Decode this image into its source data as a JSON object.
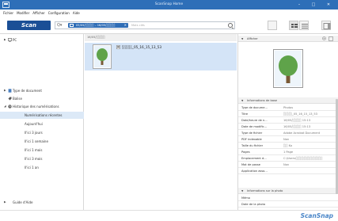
{
  "window": {
    "title": "ScanSnap Home"
  },
  "menu": [
    "Fichier",
    "Modifier",
    "Afficher",
    "Configuration",
    "Aide"
  ],
  "toolbar": {
    "scan_label": "Scan",
    "date_filter": "05/05/░░░░ – 16/05/░░░░",
    "search_placeholder": "Mots clés"
  },
  "sidebar": {
    "pc_label": "PC",
    "items": [
      {
        "label": "Type de document",
        "icon": "doc-type-icon"
      },
      {
        "label": "Balise",
        "icon": "tag-icon"
      },
      {
        "label": "Historique des numérisations",
        "icon": "history-icon"
      },
      {
        "label": "Numérisations récentes",
        "selected": true
      },
      {
        "label": "Aujourd'hui"
      },
      {
        "label": "Il'ici 3 jours"
      },
      {
        "label": "Il'ici 1 semaine"
      },
      {
        "label": "Il'ici 1 mois"
      },
      {
        "label": "Il'ici 3 mois"
      },
      {
        "label": "Il'ici 1 an"
      }
    ],
    "help_label": "Guide d'Aide"
  },
  "list": {
    "group_date": "16/05/░░░░",
    "file_name": "░░░░_05_16_15_13_53"
  },
  "details": {
    "preview_header": "Afficher",
    "basic_header": "Informations de base",
    "properties": [
      {
        "key": "Type de docume...",
        "value": "Photos"
      },
      {
        "key": "Titre",
        "value": "░░░░_05_16_15_13_53"
      },
      {
        "key": "Date/heure de n...",
        "value": "16/05/░░░░ 15:13"
      },
      {
        "key": "Date de modific...",
        "value": "16/05/░░░░ 15:13"
      },
      {
        "key": "Type de fichier",
        "value": "Adobe Acrobat Document"
      },
      {
        "key": "PDF indexable",
        "value": "Non"
      },
      {
        "key": "Taille du fichier",
        "value": "░░ Ko"
      },
      {
        "key": "Pages",
        "value": "1 Page"
      },
      {
        "key": "Emplacement d...",
        "value": "C:\\Users\\░░░░░░░░░░░░"
      },
      {
        "key": "Mot de passe",
        "value": "Non"
      },
      {
        "key": "Application asso...",
        "value": ""
      }
    ],
    "photo_header": "Informations sur la photo",
    "photo_properties": [
      {
        "key": "Mémo",
        "value": ""
      },
      {
        "key": "Date de la photo",
        "value": ""
      }
    ]
  },
  "brand": "ScanSnap",
  "colors": {
    "titlebar": "#2e6fb8",
    "scan_button": "#1b4f96",
    "selection": "#d4e4f7",
    "brand": "#4a86c8"
  }
}
